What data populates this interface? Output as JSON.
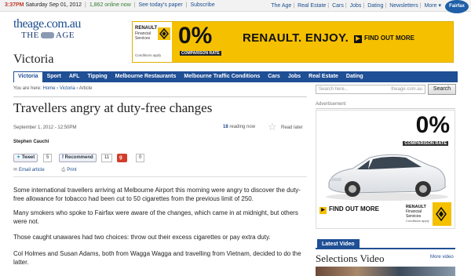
{
  "topbar": {
    "time": "3:37PM",
    "date": "Saturday Sep 01, 2012",
    "online": "1,862 online now",
    "todays_paper": "See today's paper",
    "subscribe": "Subscribe",
    "links": [
      "The Age",
      "Real Estate",
      "Cars",
      "Jobs",
      "Dating",
      "Newsletters",
      "More"
    ],
    "fairfax": "Fairfax Media"
  },
  "logo": {
    "line1": "theage.com.au",
    "line2_left": "THE",
    "line2_right": "AGE"
  },
  "banner_ad": {
    "brand": "RENAULT",
    "brand_sub": "Financial Services",
    "conditions": "Conditions apply",
    "rate": "0%",
    "comparison": "COMPARISON RATE",
    "slogan": "RENAULT. ENJOY.",
    "cta": "FIND OUT MORE",
    "colors": {
      "background": "#f5c000",
      "text": "#111111"
    }
  },
  "section_title": "Victoria",
  "nav": {
    "items": [
      "Victoria",
      "Sport",
      "AFL",
      "Tipping",
      "Melbourne Restaurants",
      "Melbourne Traffic Conditions",
      "Cars",
      "Jobs",
      "Real Estate",
      "Dating"
    ],
    "active": "Victoria"
  },
  "breadcrumb": {
    "prefix": "You are here:",
    "items": [
      "Home",
      "Victoria",
      "Article"
    ]
  },
  "search": {
    "placeholder": "Search here...",
    "domain": "theage.com.au",
    "button": "Search"
  },
  "article": {
    "headline": "Travellers angry at duty-free changes",
    "date": "September 1, 2012 - 12:50PM",
    "reading_count": "18",
    "reading_label": "reading now",
    "read_later": "Read later",
    "author": "Stephen Cauchi",
    "social": {
      "tweet": "Tweet",
      "tweet_count": "5",
      "recommend": "Recommend",
      "recommend_count": "11",
      "gplus": "+1",
      "gplus_count": "0"
    },
    "tools": {
      "email": "Email article",
      "print": "Print"
    },
    "paragraphs": [
      "Some international travellers arriving at Melbourne Airport this morning were angry to discover the duty-free allowance for tobacco had been cut to 50 cigarettes from the previous limit of 250.",
      "Many smokers who spoke to Fairfax were aware of the changes, which came in at midnight, but others were not.",
      "Those caught unawares had two choices: throw out their excess cigarettes or pay extra duty.",
      "Col Holmes and Susan Adams, both from Wagga Wagga and travelling from Vietnam, decided to do the latter."
    ]
  },
  "sidebar": {
    "advertisement": "Advertisement",
    "ad": {
      "rate": "0%",
      "comparison": "COMPARISON RATE",
      "cta": "FIND OUT MORE",
      "brand": "RENAULT",
      "brand_sub": "Financial Services",
      "conditions": "Conditions apply"
    },
    "latest_video": "Latest Video",
    "selections_title": "Selections Video",
    "more_video": "More video"
  }
}
